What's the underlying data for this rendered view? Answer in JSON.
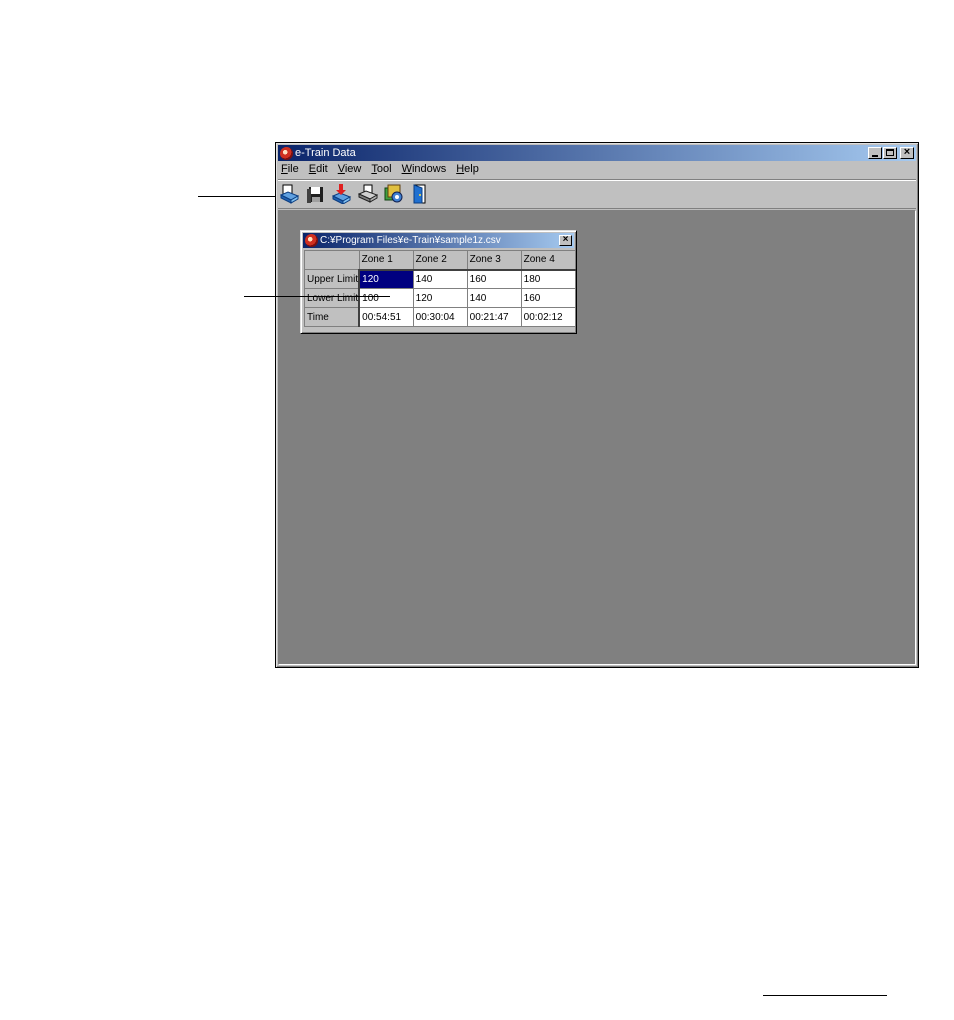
{
  "app": {
    "title": "e-Train Data",
    "minimize_glyph": "",
    "maximize_glyph": "",
    "close_glyph": "×"
  },
  "menu": [
    {
      "accel": "F",
      "rest": "ile"
    },
    {
      "accel": "E",
      "rest": "dit"
    },
    {
      "accel": "V",
      "rest": "iew"
    },
    {
      "accel": "T",
      "rest": "ool"
    },
    {
      "accel": "W",
      "rest": "indows"
    },
    {
      "accel": "H",
      "rest": "elp"
    }
  ],
  "toolbar": {
    "buttons": [
      "open-file-icon",
      "save-disk-icon",
      "download-icon",
      "print-icon",
      "settings-icon",
      "exit-door-icon"
    ]
  },
  "document": {
    "title": "C:¥Program Files¥e-Train¥sample1z.csv",
    "close_glyph": "×",
    "grid": {
      "columns": [
        "Zone 1",
        "Zone 2",
        "Zone 3",
        "Zone 4"
      ],
      "rows": [
        {
          "label": "Upper Limit",
          "cells": [
            "120",
            "140",
            "160",
            "180"
          ]
        },
        {
          "label": "Lower Limit",
          "cells": [
            "100",
            "120",
            "140",
            "160"
          ]
        },
        {
          "label": "Time",
          "cells": [
            "00:54:51",
            "00:30:04",
            "00:21:47",
            "00:02:12"
          ]
        }
      ],
      "selected_cell": "Upper Limit / Zone 1"
    }
  },
  "colors": {
    "titlebar_start": "#0a246a",
    "titlebar_end": "#a6caf0",
    "face": "#c0c0c0",
    "mdi_background": "#808080",
    "selection": "#000080"
  }
}
